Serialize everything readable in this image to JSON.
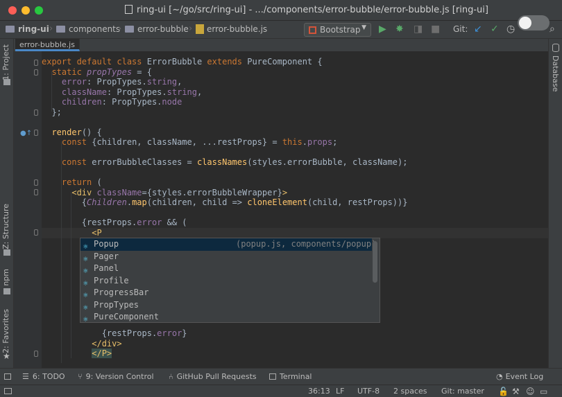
{
  "window": {
    "title": "ring-ui [~/go/src/ring-ui] - .../components/error-bubble/error-bubble.js [ring-ui]"
  },
  "breadcrumbs": [
    "ring-ui",
    "components",
    "error-bubble",
    "error-bubble.js"
  ],
  "toolbar": {
    "run_config": "Bootstrap",
    "git_label": "Git:"
  },
  "tab": {
    "label": "error-bubble.js"
  },
  "left_tools": [
    "1: Project",
    "Z: Structure",
    "npm",
    "2: Favorites"
  ],
  "right_tools": [
    "Database"
  ],
  "code": [
    "export default class ErrorBubble extends PureComponent {",
    "  static propTypes = {",
    "    error: PropTypes.string,",
    "    className: PropTypes.string,",
    "    children: PropTypes.node",
    "  };",
    "",
    "  render() {",
    "    const {children, className, ...restProps} = this.props;",
    "",
    "    const errorBubbleClasses = classNames(styles.errorBubble, className);",
    "",
    "    return (",
    "      <div className={styles.errorBubbleWrapper}>",
    "        {Children.map(children, child => cloneElement(child, restProps))}",
    "",
    "        {restProps.error && (",
    "          <P",
    "",
    "",
    "",
    "",
    "",
    "",
    "",
    "",
    "            {restProps.error}",
    "          </div>",
    "          </P>"
  ],
  "completion": {
    "items": [
      "Popup",
      "Pager",
      "Panel",
      "Profile",
      "ProgressBar",
      "PropTypes",
      "PureComponent"
    ],
    "selected_hint": "(popup.js, components/popup)"
  },
  "bottom_tools": [
    "6: TODO",
    "9: Version Control",
    "GitHub Pull Requests",
    "Terminal",
    "Event Log"
  ],
  "status": {
    "position": "36:13",
    "line_sep": "LF",
    "encoding": "UTF-8",
    "indent": "2 spaces",
    "branch": "Git: master"
  }
}
